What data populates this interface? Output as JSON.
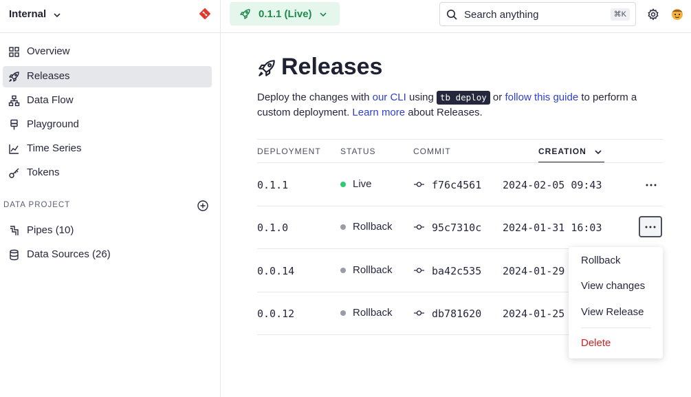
{
  "workspace": {
    "name": "Internal"
  },
  "sidebar": {
    "items": [
      {
        "label": "Overview",
        "icon": "grid-icon"
      },
      {
        "label": "Releases",
        "icon": "rocket-icon",
        "active": true
      },
      {
        "label": "Data Flow",
        "icon": "flow-icon"
      },
      {
        "label": "Playground",
        "icon": "playground-icon"
      },
      {
        "label": "Time Series",
        "icon": "chart-line-icon"
      },
      {
        "label": "Tokens",
        "icon": "key-icon"
      }
    ],
    "section_title": "DATA PROJECT",
    "project_items": [
      {
        "label": "Pipes (10)",
        "icon": "pipe-icon"
      },
      {
        "label": "Data Sources (26)",
        "icon": "database-icon"
      }
    ]
  },
  "topbar": {
    "release_label": "0.1.1 (Live)",
    "search_placeholder": "Search anything",
    "search_shortcut": "⌘K"
  },
  "main": {
    "title": "Releases",
    "desc": {
      "part1": "Deploy the changes with ",
      "link1": "our CLI",
      "part2": " using ",
      "code": "tb deploy",
      "part3": " or ",
      "link2": "follow this guide",
      "part4": " to perform a custom deployment. ",
      "link3": "Learn more",
      "part5": " about Releases."
    },
    "columns": [
      "DEPLOYMENT",
      "STATUS",
      "COMMIT",
      "CREATION"
    ],
    "rows": [
      {
        "deployment": "0.1.1",
        "status": "Live",
        "commit": "f76c4561",
        "created": "2024-02-05 09:43"
      },
      {
        "deployment": "0.1.0",
        "status": "Rollback",
        "commit": "95c7310c",
        "created": "2024-01-31 16:03"
      },
      {
        "deployment": "0.0.14",
        "status": "Rollback",
        "commit": "ba42c535",
        "created": "2024-01-29"
      },
      {
        "deployment": "0.0.12",
        "status": "Rollback",
        "commit": "db781620",
        "created": "2024-01-25"
      }
    ]
  },
  "menu": {
    "items": [
      "Rollback",
      "View changes",
      "View Release"
    ],
    "danger_item": "Delete"
  },
  "colors": {
    "live": "#2ecc71",
    "rollback": "#9a9ca6",
    "accent_green": "#1f8a4c",
    "link": "#2d3fc9",
    "danger": "#d32020"
  }
}
